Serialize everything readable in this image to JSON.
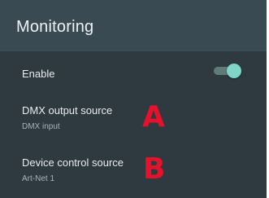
{
  "header": {
    "title": "Monitoring"
  },
  "settings": {
    "enable": {
      "label": "Enable",
      "enabled": true
    },
    "dmx_output_source": {
      "label": "DMX output source",
      "value": "DMX input",
      "marker": "A"
    },
    "device_control_source": {
      "label": "Device control source",
      "value": "Art-Net 1",
      "marker": "B"
    }
  },
  "colors": {
    "header_bg": "#3a4a53",
    "panel_bg": "#2e3940",
    "toggle_track": "#5f7c78",
    "toggle_thumb": "#7fd6c8",
    "marker": "#e4122a"
  }
}
